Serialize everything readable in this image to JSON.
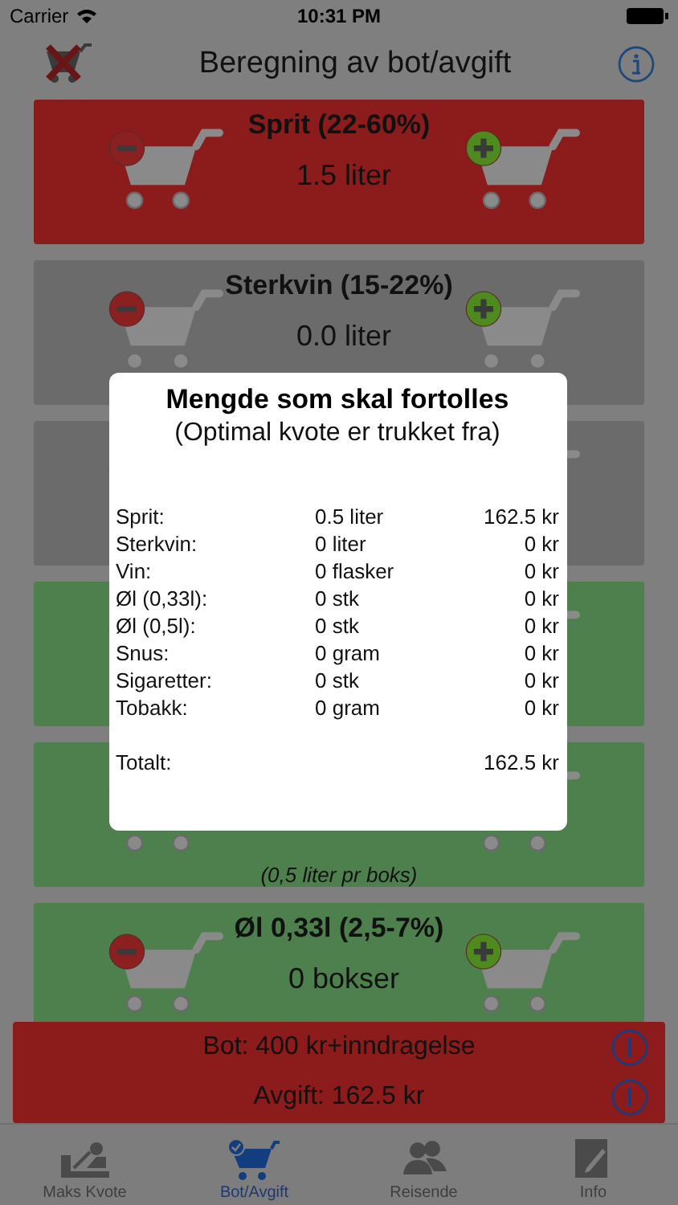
{
  "status_bar": {
    "carrier": "Carrier",
    "time": "10:31 PM"
  },
  "nav": {
    "title": "Beregning av bot/avgift"
  },
  "cards": [
    {
      "color": "#8c1b1b",
      "title": "Sprit (22-60%)",
      "amount": "1.5 liter"
    },
    {
      "color": "#6b6b6b",
      "title": "Sterkvin (15-22%)",
      "amount": "0.0 liter"
    },
    {
      "color": "#6b6b6b"
    },
    {
      "color": "#4d804d"
    },
    {
      "color": "#4d804d",
      "note": "(0,5 liter pr boks)"
    },
    {
      "color": "#4d804d",
      "title": "Øl 0,33l (2,5-7%)",
      "amount": "0 bokser"
    }
  ],
  "dialog": {
    "title": "Mengde som skal fortolles",
    "subtitle": "(Optimal kvote er trukket fra)",
    "rows": [
      {
        "label": "Sprit:",
        "quantity": "0.5 liter",
        "amount": "162.5 kr"
      },
      {
        "label": "Sterkvin:",
        "quantity": "0 liter",
        "amount": "0 kr"
      },
      {
        "label": "Vin:",
        "quantity": "0 flasker",
        "amount": "0 kr"
      },
      {
        "label": "Øl (0,33l):",
        "quantity": "0 stk",
        "amount": "0 kr"
      },
      {
        "label": "Øl (0,5l):",
        "quantity": "0 stk",
        "amount": "0 kr"
      },
      {
        "label": "Snus:",
        "quantity": "0 gram",
        "amount": "0 kr"
      },
      {
        "label": "Sigaretter:",
        "quantity": "0 stk",
        "amount": "0 kr"
      },
      {
        "label": "Tobakk:",
        "quantity": "0 gram",
        "amount": "0 kr"
      }
    ],
    "total": {
      "label": "Totalt:",
      "amount": "162.5 kr"
    }
  },
  "summary": {
    "lines": [
      "Bot: 400 kr+inndragelse",
      "Avgift: 162.5 kr"
    ]
  },
  "tabs": [
    {
      "label": "Maks Kvote",
      "selected": false,
      "kind": "customs"
    },
    {
      "label": "Bot/Avgift",
      "selected": true,
      "kind": "cart"
    },
    {
      "label": "Reisende",
      "selected": false,
      "kind": "people"
    },
    {
      "label": "Info",
      "selected": false,
      "kind": "note"
    }
  ]
}
